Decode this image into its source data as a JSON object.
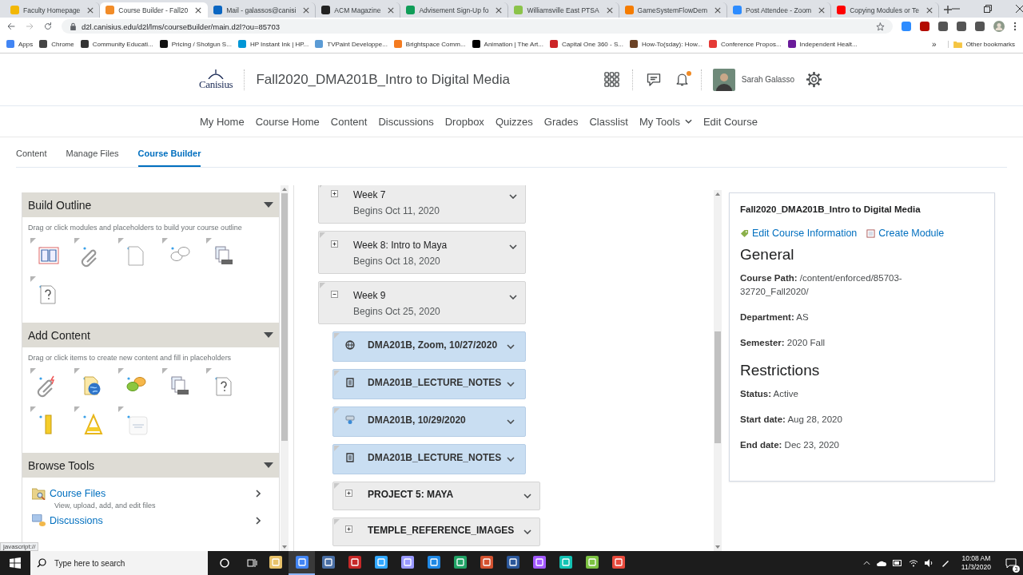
{
  "browser": {
    "tabs": [
      {
        "title": "Faculty Homepage",
        "color": "#f2b705",
        "selected": false
      },
      {
        "title": "Course Builder - Fall20",
        "color": "#f28c28",
        "selected": true
      },
      {
        "title": "Mail - galassos@canisi",
        "color": "#0a66c2",
        "selected": false
      },
      {
        "title": "ACM Magazine",
        "color": "#222222",
        "selected": false
      },
      {
        "title": "Advisement Sign-Up fo",
        "color": "#0f9d58",
        "selected": false
      },
      {
        "title": "Williamsville East PTSA",
        "color": "#8bc34a",
        "selected": false
      },
      {
        "title": "GameSystemFlowDem",
        "color": "#f57c00",
        "selected": false
      },
      {
        "title": "Post Attendee - Zoom",
        "color": "#2d8cff",
        "selected": false
      },
      {
        "title": "Copying Modules or Te",
        "color": "#ff0000",
        "selected": false
      }
    ],
    "address": "d2l.canisius.edu/d2l/lms/courseBuilder/main.d2l?ou=85703",
    "bookmarks": [
      {
        "label": "Apps",
        "color": "#4285f4"
      },
      {
        "label": "Chrome",
        "color": "#444444"
      },
      {
        "label": "Community Educati...",
        "color": "#333333"
      },
      {
        "label": "Pricing / Shotgun S...",
        "color": "#111111"
      },
      {
        "label": "HP Instant Ink | HP...",
        "color": "#0096d6"
      },
      {
        "label": "TVPaint Developpe...",
        "color": "#5b9bd5"
      },
      {
        "label": "Brightspace Comm...",
        "color": "#f47b20"
      },
      {
        "label": "Animation | The Art...",
        "color": "#000000"
      },
      {
        "label": "Capital One 360 - S...",
        "color": "#cc2427"
      },
      {
        "label": "How-To(sday): How...",
        "color": "#6b4226"
      },
      {
        "label": "Conference Propos...",
        "color": "#e53935"
      },
      {
        "label": "Independent Healt...",
        "color": "#6a1b9a"
      }
    ],
    "more_bookmarks": "»",
    "other_bookmarks": "Other bookmarks",
    "status_text": "javascript://"
  },
  "header": {
    "logo": "Canisius",
    "course_title": "Fall2020_DMA201B_Intro to Digital Media",
    "has_notification": true,
    "user_name": "Sarah Galasso"
  },
  "nav": [
    {
      "label": "My Home",
      "menu": false
    },
    {
      "label": "Course Home",
      "menu": false
    },
    {
      "label": "Content",
      "menu": false
    },
    {
      "label": "Discussions",
      "menu": false
    },
    {
      "label": "Dropbox",
      "menu": false
    },
    {
      "label": "Quizzes",
      "menu": false
    },
    {
      "label": "Grades",
      "menu": false
    },
    {
      "label": "Classlist",
      "menu": false
    },
    {
      "label": "My Tools",
      "menu": true
    },
    {
      "label": "Edit Course",
      "menu": false
    }
  ],
  "subtabs": [
    {
      "label": "Content",
      "selected": false
    },
    {
      "label": "Manage Files",
      "selected": false
    },
    {
      "label": "Course Builder",
      "selected": true
    }
  ],
  "build_panel": {
    "sections": [
      {
        "title": "Build Outline",
        "expanded": true,
        "hint": "Drag or click modules and placeholders to build your course outline",
        "tools": [
          {
            "kind": "module"
          },
          {
            "kind": "link"
          },
          {
            "kind": "page"
          },
          {
            "kind": "discussion"
          },
          {
            "kind": "upload"
          },
          {
            "kind": "quiz"
          }
        ]
      },
      {
        "title": "Add Content",
        "expanded": true,
        "hint": "Drag or click items to create new content and fill in placeholders",
        "tools": [
          {
            "kind": "link-color"
          },
          {
            "kind": "web"
          },
          {
            "kind": "discussion-color"
          },
          {
            "kind": "upload"
          },
          {
            "kind": "quiz"
          },
          {
            "kind": "checklist"
          },
          {
            "kind": "survey"
          },
          {
            "kind": "card"
          }
        ]
      },
      {
        "title": "Browse Tools",
        "expanded": true,
        "links": [
          {
            "kind": "files",
            "title": "Course Files",
            "description": "View, upload, add, and edit files"
          },
          {
            "kind": "discussions",
            "title": "Discussions"
          }
        ]
      }
    ]
  },
  "outline": {
    "modules": [
      {
        "kind": "module",
        "title": "Week 7",
        "subtitle": "Begins Oct 11, 2020",
        "expanded": false
      },
      {
        "kind": "module",
        "title": "Week 8: Intro to Maya",
        "subtitle": "Begins Oct 18, 2020",
        "expanded": false
      },
      {
        "kind": "module",
        "title": "Week 9",
        "subtitle": "Begins Oct 25, 2020",
        "expanded": true,
        "children": [
          {
            "kind": "web-link",
            "title": "DMA201B, Zoom, 10/27/2020"
          },
          {
            "kind": "file",
            "title": "DMA201B_LECTURE_NOTES"
          },
          {
            "kind": "video-link",
            "title": "DMA201B, 10/29/2020"
          },
          {
            "kind": "file",
            "title": "DMA201B_LECTURE_NOTES"
          },
          {
            "kind": "module",
            "title": "PROJECT 5: MAYA",
            "expanded": false
          },
          {
            "kind": "module",
            "title": "TEMPLE_REFERENCE_IMAGES",
            "expanded": false
          }
        ]
      }
    ]
  },
  "course_info": {
    "title": "Fall2020_DMA201B_Intro to Digital Media",
    "actions": [
      {
        "kind": "edit",
        "label": "Edit Course Information"
      },
      {
        "kind": "create",
        "label": "Create Module"
      }
    ],
    "sections": [
      {
        "heading": "General",
        "fields": [
          {
            "label": "Course Path:",
            "value": "/content/enforced/85703-32720_Fall2020/"
          },
          {
            "label": "Department:",
            "value": "AS"
          },
          {
            "label": "Semester:",
            "value": "2020 Fall"
          }
        ]
      },
      {
        "heading": "Restrictions",
        "fields": [
          {
            "label": "Status:",
            "value": "Active"
          },
          {
            "label": "Start date:",
            "value": "Aug 28, 2020"
          },
          {
            "label": "End date:",
            "value": "Dec 23, 2020"
          }
        ]
      }
    ]
  },
  "taskbar": {
    "search_placeholder": "Type here to search",
    "apps": [
      {
        "color": "#e8c26a",
        "active": false
      },
      {
        "color": "#4285f4",
        "active": true
      },
      {
        "color": "#4a6fa5",
        "active": false
      },
      {
        "color": "#c62828",
        "active": false
      },
      {
        "color": "#31a8ff",
        "active": false
      },
      {
        "color": "#9999ff",
        "active": false
      },
      {
        "color": "#1e88e5",
        "active": false
      },
      {
        "color": "#21a366",
        "active": false
      },
      {
        "color": "#d35230",
        "active": false
      },
      {
        "color": "#2b579a",
        "active": false
      },
      {
        "color": "#a259ff",
        "active": false
      },
      {
        "color": "#13c2b3",
        "active": false
      },
      {
        "color": "#7cc242",
        "active": false
      },
      {
        "color": "#e84a3c",
        "active": false
      }
    ],
    "time": "10:08 AM",
    "date": "11/3/2020",
    "notifications": "3"
  }
}
